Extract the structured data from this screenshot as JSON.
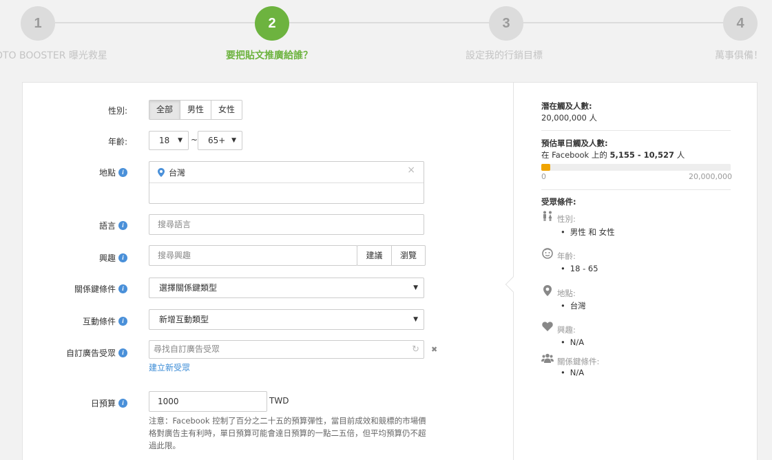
{
  "steps": [
    {
      "num": "1",
      "label": "PHOTO BOOSTER 曝光救星"
    },
    {
      "num": "2",
      "label": "要把貼文推廣給誰？"
    },
    {
      "num": "3",
      "label": "設定我的行銷目標"
    },
    {
      "num": "4",
      "label": "萬事俱備！"
    }
  ],
  "form": {
    "gender": {
      "label": "性別:",
      "options": [
        "全部",
        "男性",
        "女性"
      ],
      "selected": "全部"
    },
    "age": {
      "label": "年齡:",
      "min": "18",
      "sep": "~",
      "max": "65+"
    },
    "location": {
      "label": "地點",
      "value": "台灣",
      "clear": "×"
    },
    "language": {
      "label": "語言",
      "placeholder": "搜尋語言"
    },
    "interest": {
      "label": "興趣",
      "placeholder": "搜尋興趣",
      "suggest": "建議",
      "browse": "瀏覽"
    },
    "keyword": {
      "label": "關係鍵條件",
      "value": "選擇關係鍵類型"
    },
    "engagement": {
      "label": "互動條件",
      "value": "新增互動類型"
    },
    "custom_audience": {
      "label": "自訂廣告受眾",
      "placeholder": "尋找自訂廣告受眾",
      "remove": "✖",
      "create_link": "建立新受眾"
    },
    "budget": {
      "label": "日預算",
      "value": "1000",
      "currency": "TWD",
      "note": "注意：Facebook 控制了百分之二十五的預算彈性，當目前成效和競標的市場價格對廣告主有利時，單日預算可能會達日預算的一點二五倍，但平均預算仍不超過此限。"
    }
  },
  "summary": {
    "potential_title": "潛在觸及人數:",
    "potential_value": "20,000,000 人",
    "daily_title": "預估單日觸及人數:",
    "daily_prefix": "在 Facebook 上的 ",
    "daily_range": "5,155 - 10,527",
    "daily_suffix": " 人",
    "daily_fraction": 0.0004,
    "bar_min": "0",
    "bar_max": "20,000,000",
    "criteria_title": "受眾條件:",
    "criteria": [
      {
        "icon": "gender-icon",
        "label": "性別:",
        "value": "男性 和 女性"
      },
      {
        "icon": "age-icon",
        "label": "年齡:",
        "value": "18 - 65"
      },
      {
        "icon": "location-icon",
        "label": "地點:",
        "value": "台灣"
      },
      {
        "icon": "heart-icon",
        "label": "興趣:",
        "value": "N/A"
      },
      {
        "icon": "people-icon",
        "label": "關係鍵條件:",
        "value": "N/A"
      }
    ]
  },
  "colors": {
    "accent": "#6db33f",
    "info": "#4a90d9",
    "link": "#3a8bd6",
    "bar": "#f0a400"
  }
}
